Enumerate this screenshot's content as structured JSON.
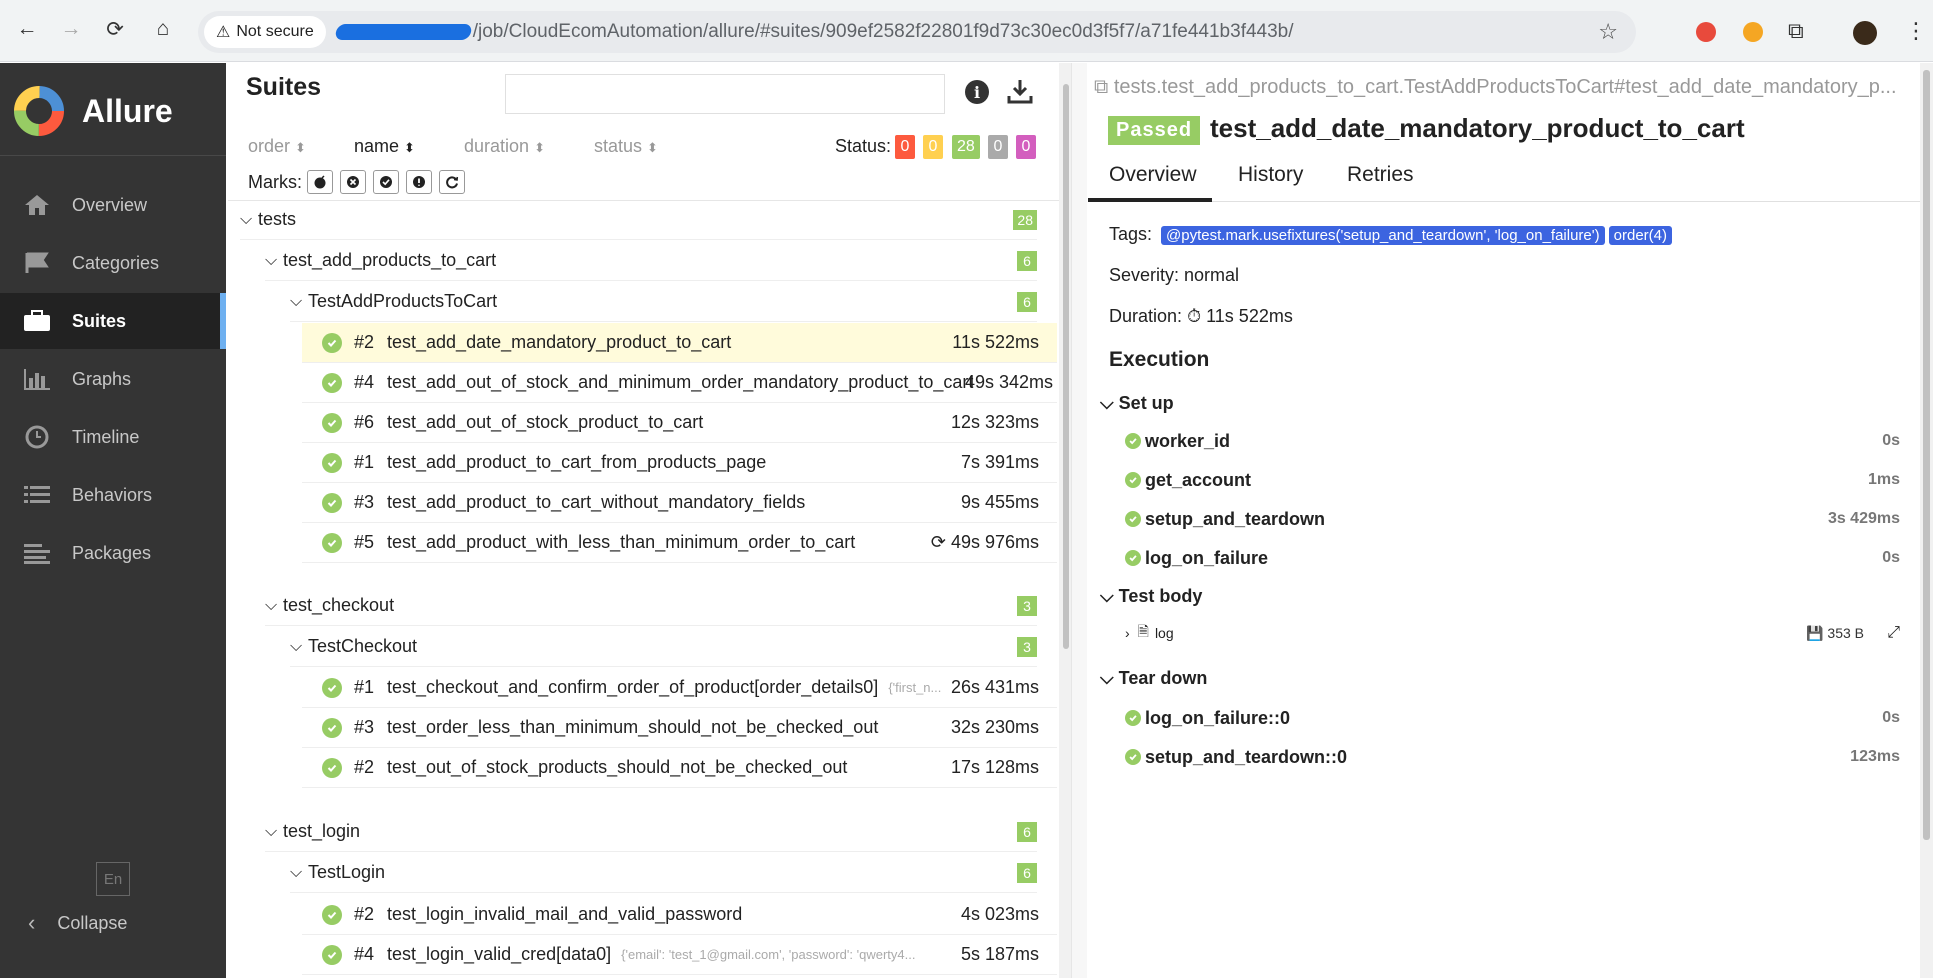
{
  "browser": {
    "not_secure": "Not secure",
    "url_path": "/job/CloudEcomAutomation/allure/#suites/909ef2582f22801f9d73c30ec0d3f5f7/a71fe441b3f443b/"
  },
  "sidebar": {
    "brand": "Allure",
    "items": [
      {
        "label": "Overview",
        "icon": "home-icon"
      },
      {
        "label": "Categories",
        "icon": "flag-icon"
      },
      {
        "label": "Suites",
        "icon": "briefcase-icon"
      },
      {
        "label": "Graphs",
        "icon": "bar-chart-icon"
      },
      {
        "label": "Timeline",
        "icon": "clock-icon"
      },
      {
        "label": "Behaviors",
        "icon": "list-icon"
      },
      {
        "label": "Packages",
        "icon": "align-left-icon"
      }
    ],
    "lang": "En",
    "collapse": "Collapse"
  },
  "suites": {
    "title": "Suites",
    "sort": [
      "order",
      "name",
      "duration",
      "status"
    ],
    "status_label": "Status:",
    "status_counts": [
      {
        "value": "0",
        "color": "#fd5a3e"
      },
      {
        "value": "0",
        "color": "#ffd050"
      },
      {
        "value": "28",
        "color": "#97cc64"
      },
      {
        "value": "0",
        "color": "#aaaaaa"
      },
      {
        "value": "0",
        "color": "#d35ebe"
      }
    ],
    "marks_label": "Marks:",
    "tree": {
      "root": {
        "label": "tests",
        "count": "28"
      },
      "groups": [
        {
          "label": "test_add_products_to_cart",
          "count": "6",
          "cls": {
            "label": "TestAddProductsToCart",
            "count": "6"
          },
          "tests": [
            {
              "order": "#2",
              "name": "test_add_date_mandatory_product_to_cart",
              "params": "",
              "duration": "11s 522ms"
            },
            {
              "order": "#4",
              "name": "test_add_out_of_stock_and_minimum_order_mandatory_product_to_cart",
              "params": "",
              "duration": "49s 342ms"
            },
            {
              "order": "#6",
              "name": "test_add_out_of_stock_product_to_cart",
              "params": "",
              "duration": "12s 323ms"
            },
            {
              "order": "#1",
              "name": "test_add_product_to_cart_from_products_page",
              "params": "",
              "duration": "7s 391ms"
            },
            {
              "order": "#3",
              "name": "test_add_product_to_cart_without_mandatory_fields",
              "params": "",
              "duration": "9s 455ms"
            },
            {
              "order": "#5",
              "name": "test_add_product_with_less_than_minimum_order_to_cart",
              "params": "",
              "duration": "49s 976ms"
            }
          ]
        },
        {
          "label": "test_checkout",
          "count": "3",
          "cls": {
            "label": "TestCheckout",
            "count": "3"
          },
          "tests": [
            {
              "order": "#1",
              "name": "test_checkout_and_confirm_order_of_product[order_details0]",
              "params": "{'first_n...",
              "duration": "26s 431ms"
            },
            {
              "order": "#3",
              "name": "test_order_less_than_minimum_should_not_be_checked_out",
              "params": "",
              "duration": "32s 230ms"
            },
            {
              "order": "#2",
              "name": "test_out_of_stock_products_should_not_be_checked_out",
              "params": "",
              "duration": "17s 128ms"
            }
          ]
        },
        {
          "label": "test_login",
          "count": "6",
          "cls": {
            "label": "TestLogin",
            "count": "6"
          },
          "tests": [
            {
              "order": "#2",
              "name": "test_login_invalid_mail_and_valid_password",
              "params": "",
              "duration": "4s 023ms"
            },
            {
              "order": "#4",
              "name": "test_login_valid_cred[data0]",
              "params": "{'email': 'test_1@gmail.com', 'password': 'qwerty4...",
              "duration": "5s 187ms"
            }
          ]
        }
      ]
    }
  },
  "detail": {
    "path": "tests.test_add_products_to_cart.TestAddProductsToCart#test_add_date_mandatory_p...",
    "status": "Passed",
    "title": "test_add_date_mandatory_product_to_cart",
    "tabs": [
      "Overview",
      "History",
      "Retries"
    ],
    "tags_label": "Tags:",
    "tags": [
      "@pytest.mark.usefixtures('setup_and_teardown', 'log_on_failure')",
      "order(4)"
    ],
    "severity": "Severity: normal",
    "duration_label": "Duration:",
    "duration": "11s 522ms",
    "execution": "Execution",
    "setup_label": "Set up",
    "setup": [
      {
        "name": "worker_id",
        "duration": "0s"
      },
      {
        "name": "get_account",
        "duration": "1ms"
      },
      {
        "name": "setup_and_teardown",
        "duration": "3s 429ms"
      },
      {
        "name": "log_on_failure",
        "duration": "0s"
      }
    ],
    "body_label": "Test body",
    "attachment": {
      "name": "log",
      "size": "353 B"
    },
    "teardown_label": "Tear down",
    "teardown": [
      {
        "name": "log_on_failure::0",
        "duration": "0s"
      },
      {
        "name": "setup_and_teardown::0",
        "duration": "123ms"
      }
    ]
  }
}
